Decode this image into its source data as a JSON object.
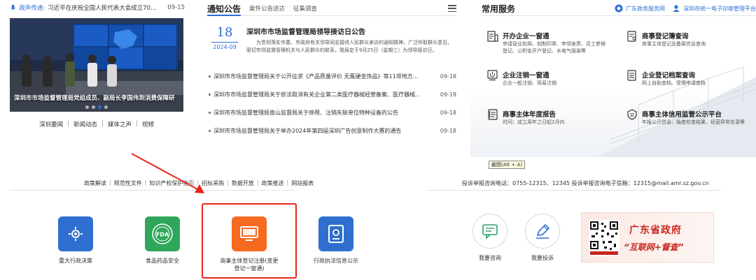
{
  "ticker": {
    "label": "政声传递:",
    "text": "习近平在庆祝全国人民代表大会成立70周年...",
    "date": "09-15"
  },
  "photo": {
    "caption": "深圳市市场监督管理局党组成员、副局长李国伟到消费保障研"
  },
  "left_links": [
    "深圳要闻",
    "新闻动态",
    "媒体之声",
    "视频"
  ],
  "notice": {
    "title": "通知公告",
    "tabs": [
      "案件公告送达",
      "征集调查"
    ],
    "featured": {
      "day": "18",
      "year_month": "2024-09",
      "title": "深圳市市场监督管理局领导接访日公告",
      "body": "为贯彻落实市委、市政府有关领导同志接待人民群众来访的通知精神，广泛听取群众意见，密切市场监督管理机关与人民群众的联系，我局定于9月25日（星期三）为领导接访日。"
    },
    "items": [
      {
        "text": "深圳市市场监督管理局关于公开征求《产品质量评价 无氟硬金饰品》等11项地方...",
        "date": "09-18"
      },
      {
        "text": "深圳市市场监督管理局关于依法取消有关企业第二类医疗器械经营备案、医疗器械...",
        "date": "09-18"
      },
      {
        "text": "深圳市市场监督管理局南山监督局关于停用、注销失联单位特种设备的公告",
        "date": "09-18"
      },
      {
        "text": "深圳市市场监督管理局关于举办2024年第四届深圳广告创意制作大赛的通告",
        "date": "09-18"
      }
    ]
  },
  "services": {
    "title": "常用服务",
    "links": [
      "广东政务服务网",
      "深圳市统一电子印章管理平台"
    ],
    "items": [
      {
        "title": "开办企业一窗通",
        "desc": "申请营业执照、刻制印章、申领发票、员工参保登记、公积金开户登记、水电气报装等",
        "icon": "building-form-icon"
      },
      {
        "title": "商事登记簿查询",
        "desc": "商事主体登记及备案信息查询",
        "icon": "register-book-icon"
      },
      {
        "title": "企业注销一窗通",
        "desc": "企业一般注销、简易注销",
        "icon": "power-doc-icon"
      },
      {
        "title": "企业登记档案查询",
        "desc": "网上自助查档、受理申请查档",
        "icon": "archive-icon"
      },
      {
        "title": "商事主体年度报告",
        "desc": "时间：成立周年之日起2月内",
        "icon": "annual-report-icon"
      },
      {
        "title": "商事主体信用监管公示平台",
        "desc": "年报公示信息、抽查检查结果、经营异常名录等",
        "icon": "credit-platform-icon"
      }
    ]
  },
  "tooltip": "截图(Alt + A)",
  "bottom_links": [
    "政策解读",
    "规范性文件",
    "知识产权保护指引",
    "招标采购",
    "数据开放",
    "政策推送",
    "网站报表"
  ],
  "contact": {
    "text": "投诉举报咨询电话：0755-12315、12345    投诉举报咨询电子信箱：12315@mail.amr.sz.gov.cn"
  },
  "tiles": [
    {
      "label": "重大行政决策",
      "color": "#2f6fd0",
      "icon": "people-gear-icon"
    },
    {
      "label": "食品药品安全",
      "color": "#2fa65a",
      "icon": "fda-badge-icon",
      "badge": "FDA"
    },
    {
      "label": "商事主体登记注册(变更登记一窗通)",
      "color": "#f56a1f",
      "icon": "monitor-icon"
    },
    {
      "label": "行政执法信息公示",
      "color": "#2f6fd0",
      "icon": "id-card-icon"
    }
  ],
  "circles": [
    {
      "label": "我要咨询",
      "icon": "chat-icon"
    },
    {
      "label": "我要投诉",
      "icon": "pen-icon"
    }
  ],
  "banner": {
    "line1": "广东省政府",
    "line2": "“互联网+督查”"
  }
}
